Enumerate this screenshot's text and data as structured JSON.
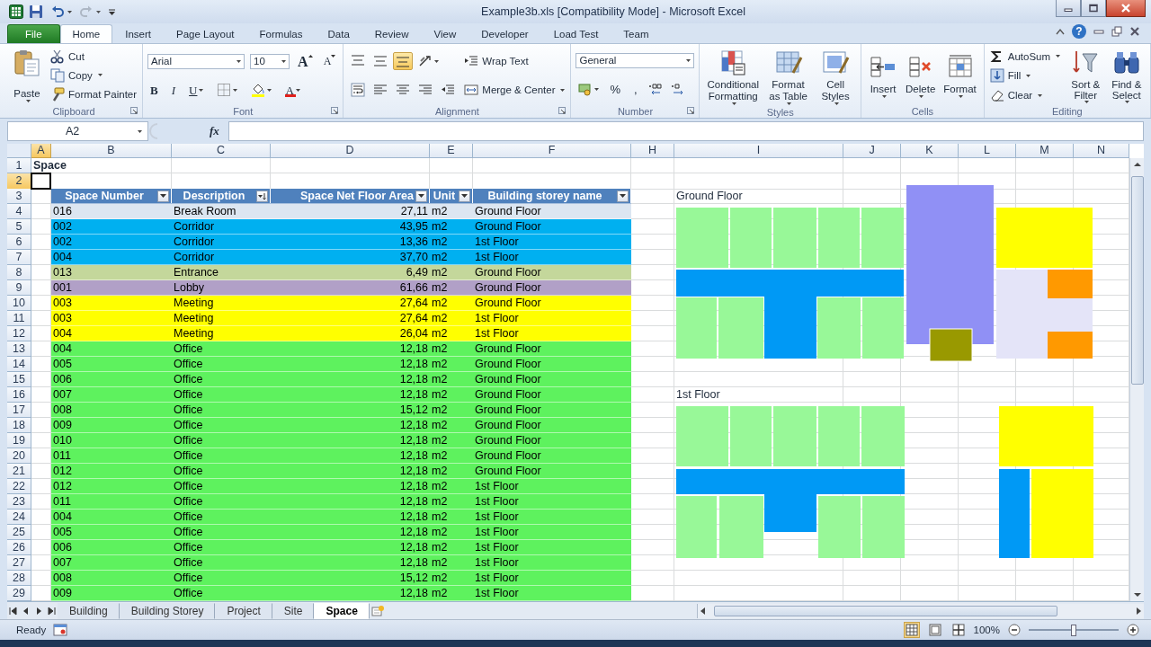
{
  "window": {
    "title": "Example3b.xls  [Compatibility Mode]  -  Microsoft Excel",
    "help": "?"
  },
  "ribbon_tabs": [
    {
      "label": "File",
      "kind": "file",
      "selected": false
    },
    {
      "label": "Home",
      "kind": "tab",
      "selected": true
    },
    {
      "label": "Insert",
      "kind": "tab",
      "selected": false
    },
    {
      "label": "Page Layout",
      "kind": "tab",
      "selected": false
    },
    {
      "label": "Formulas",
      "kind": "tab",
      "selected": false
    },
    {
      "label": "Data",
      "kind": "tab",
      "selected": false
    },
    {
      "label": "Review",
      "kind": "tab",
      "selected": false
    },
    {
      "label": "View",
      "kind": "tab",
      "selected": false
    },
    {
      "label": "Developer",
      "kind": "tab",
      "selected": false
    },
    {
      "label": "Load Test",
      "kind": "tab",
      "selected": false
    },
    {
      "label": "Team",
      "kind": "tab",
      "selected": false
    }
  ],
  "ribbon_groups": [
    {
      "title": "Clipboard",
      "launcher": true,
      "columns": [
        {
          "rows": [
            [
              {
                "kind": "large",
                "label": "Paste",
                "dropdown": true
              }
            ]
          ]
        },
        {
          "rows": [
            [
              {
                "kind": "small",
                "label": "Cut",
                "dropdown": false
              }
            ],
            [
              {
                "kind": "small",
                "label": "Copy",
                "dropdown": true
              }
            ],
            [
              {
                "kind": "small",
                "label": "Format Painter",
                "dropdown": false
              }
            ]
          ]
        }
      ]
    },
    {
      "title": "Font",
      "launcher": true,
      "columns": [
        {
          "rows": [
            [
              {
                "kind": "combo",
                "value": "Arial",
                "dropdown": true
              },
              {
                "kind": "combo",
                "value": "10",
                "dropdown": true
              },
              {
                "kind": "grow",
                "text": "A",
                "dropdown": false
              },
              {
                "kind": "shrink",
                "text": "A",
                "dropdown": false
              }
            ],
            [
              {
                "kind": "bold",
                "text": "B",
                "dropdown": false
              },
              {
                "kind": "italic",
                "text": "I",
                "dropdown": false
              },
              {
                "kind": "underline",
                "text": "U",
                "dropdown": true
              },
              {
                "kind": "icon",
                "dropdown": true
              },
              {
                "kind": "icon",
                "dropdown": true
              },
              {
                "kind": "fontcolor",
                "text": "A",
                "dropdown": true
              }
            ]
          ]
        }
      ]
    },
    {
      "title": "Alignment",
      "launcher": true,
      "columns": [
        {
          "rows": [
            [
              {
                "kind": "icon",
                "dropdown": false,
                "selected": false
              },
              {
                "kind": "icon",
                "dropdown": false,
                "selected": false
              },
              {
                "kind": "icon",
                "dropdown": false,
                "selected": true
              },
              {
                "kind": "icon",
                "dropdown": true
              }
            ],
            [
              {
                "kind": "icon",
                "dropdown": false,
                "selected": false
              },
              {
                "kind": "icon",
                "dropdown": false,
                "selected": false
              },
              {
                "kind": "icon",
                "dropdown": false,
                "selected": false
              },
              {
                "kind": "icon",
                "dropdown": false
              },
              {
                "kind": "icon",
                "dropdown": false
              }
            ]
          ]
        },
        {
          "rows": [
            [
              {
                "kind": "small",
                "label": "Wrap Text",
                "dropdown": false
              }
            ],
            [
              {
                "kind": "small",
                "label": "Merge & Center",
                "dropdown": true
              }
            ]
          ]
        }
      ]
    },
    {
      "title": "Number",
      "launcher": true,
      "columns": [
        {
          "rows": [
            [
              {
                "kind": "combo",
                "value": "General",
                "dropdown": true
              }
            ],
            [
              {
                "kind": "icon",
                "dropdown": true
              },
              {
                "kind": "symbol",
                "text": "%",
                "dropdown": false
              },
              {
                "kind": "symbol",
                "text": ",",
                "dropdown": false
              },
              {
                "kind": "icon",
                "dropdown": false
              },
              {
                "kind": "icon",
                "dropdown": false
              }
            ]
          ]
        }
      ]
    },
    {
      "title": "Styles",
      "launcher": false,
      "columns": [
        {
          "rows": [
            [
              {
                "kind": "large",
                "label": "Conditional Formatting",
                "dropdown": true
              },
              {
                "kind": "large",
                "label": "Format as Table",
                "dropdown": true
              },
              {
                "kind": "large",
                "label": "Cell Styles",
                "dropdown": true
              }
            ]
          ]
        }
      ]
    },
    {
      "title": "Cells",
      "launcher": false,
      "columns": [
        {
          "rows": [
            [
              {
                "kind": "large",
                "label": "Insert",
                "dropdown": true
              },
              {
                "kind": "large",
                "label": "Delete",
                "dropdown": true
              },
              {
                "kind": "large",
                "label": "Format",
                "dropdown": true
              }
            ]
          ]
        }
      ]
    },
    {
      "title": "Editing",
      "launcher": false,
      "columns": [
        {
          "rows": [
            [
              {
                "kind": "small",
                "label": "AutoSum",
                "dropdown": true
              }
            ],
            [
              {
                "kind": "small",
                "label": "Fill",
                "dropdown": true
              }
            ],
            [
              {
                "kind": "small",
                "label": "Clear",
                "dropdown": true
              }
            ]
          ]
        },
        {
          "rows": [
            [
              {
                "kind": "large",
                "label": "Sort & Filter",
                "dropdown": true
              },
              {
                "kind": "large",
                "label": "Find & Select",
                "dropdown": true
              }
            ]
          ]
        }
      ]
    }
  ],
  "formula_bar": {
    "name_box": "A2",
    "function_button": "fx"
  },
  "sheet": {
    "columns": [
      {
        "label": "A",
        "selected": true
      },
      {
        "label": "B",
        "selected": false
      },
      {
        "label": "C",
        "selected": false
      },
      {
        "label": "D",
        "selected": false
      },
      {
        "label": "E",
        "selected": false
      },
      {
        "label": "F",
        "selected": false
      },
      {
        "label": "H",
        "selected": false
      },
      {
        "label": "I",
        "selected": false
      },
      {
        "label": "J",
        "selected": false
      },
      {
        "label": "K",
        "selected": false
      },
      {
        "label": "L",
        "selected": false
      },
      {
        "label": "M",
        "selected": false
      },
      {
        "label": "N",
        "selected": false
      }
    ],
    "row_headers": [
      {
        "label": "1",
        "selected": false
      },
      {
        "label": "2",
        "selected": true
      },
      {
        "label": "3",
        "selected": false
      },
      {
        "label": "4",
        "selected": false
      },
      {
        "label": "5",
        "selected": false
      },
      {
        "label": "6",
        "selected": false
      },
      {
        "label": "7",
        "selected": false
      },
      {
        "label": "8",
        "selected": false
      },
      {
        "label": "9",
        "selected": false
      },
      {
        "label": "10",
        "selected": false
      },
      {
        "label": "11",
        "selected": false
      },
      {
        "label": "12",
        "selected": false
      },
      {
        "label": "13",
        "selected": false
      },
      {
        "label": "14",
        "selected": false
      },
      {
        "label": "15",
        "selected": false
      },
      {
        "label": "16",
        "selected": false
      },
      {
        "label": "17",
        "selected": false
      },
      {
        "label": "18",
        "selected": false
      },
      {
        "label": "19",
        "selected": false
      },
      {
        "label": "20",
        "selected": false
      },
      {
        "label": "21",
        "selected": false
      },
      {
        "label": "22",
        "selected": false
      },
      {
        "label": "23",
        "selected": false
      },
      {
        "label": "24",
        "selected": false
      },
      {
        "label": "25",
        "selected": false
      },
      {
        "label": "26",
        "selected": false
      },
      {
        "label": "27",
        "selected": false
      },
      {
        "label": "28",
        "selected": false
      },
      {
        "label": "29",
        "selected": false
      }
    ],
    "title_cell": "Space",
    "plan_labels": [
      "Ground Floor",
      "1st Floor"
    ],
    "table": {
      "columns": [
        {
          "label": "Space Number",
          "sorted": false
        },
        {
          "label": "Description",
          "sorted": true
        },
        {
          "label": "Space Net Floor Area",
          "sorted": false
        },
        {
          "label": "Unit",
          "sorted": false
        },
        {
          "label": "Building storey name",
          "sorted": false
        }
      ],
      "rows": [
        {
          "number": "016",
          "description": "Break Room",
          "area": "27,11",
          "unit": "m2",
          "storey": "Ground Floor",
          "color": "#dce6f1"
        },
        {
          "number": "002",
          "description": "Corridor",
          "area": "43,95",
          "unit": "m2",
          "storey": "Ground Floor",
          "color": "#00b0f0"
        },
        {
          "number": "002",
          "description": "Corridor",
          "area": "13,36",
          "unit": "m2",
          "storey": "1st Floor",
          "color": "#00b0f0"
        },
        {
          "number": "004",
          "description": "Corridor",
          "area": "37,70",
          "unit": "m2",
          "storey": "1st Floor",
          "color": "#00b0f0"
        },
        {
          "number": "013",
          "description": "Entrance",
          "area": "6,49",
          "unit": "m2",
          "storey": "Ground Floor",
          "color": "#c4d79b"
        },
        {
          "number": "001",
          "description": "Lobby",
          "area": "61,66",
          "unit": "m2",
          "storey": "Ground Floor",
          "color": "#b1a0c7"
        },
        {
          "number": "003",
          "description": "Meeting",
          "area": "27,64",
          "unit": "m2",
          "storey": "Ground Floor",
          "color": "#ffff00"
        },
        {
          "number": "003",
          "description": "Meeting",
          "area": "27,64",
          "unit": "m2",
          "storey": "1st Floor",
          "color": "#ffff00"
        },
        {
          "number": "004",
          "description": "Meeting",
          "area": "26,04",
          "unit": "m2",
          "storey": "1st Floor",
          "color": "#ffff00"
        },
        {
          "number": "004",
          "description": "Office",
          "area": "12,18",
          "unit": "m2",
          "storey": "Ground Floor",
          "color": "#5ef25e"
        },
        {
          "number": "005",
          "description": "Office",
          "area": "12,18",
          "unit": "m2",
          "storey": "Ground Floor",
          "color": "#5ef25e"
        },
        {
          "number": "006",
          "description": "Office",
          "area": "12,18",
          "unit": "m2",
          "storey": "Ground Floor",
          "color": "#5ef25e"
        },
        {
          "number": "007",
          "description": "Office",
          "area": "12,18",
          "unit": "m2",
          "storey": "Ground Floor",
          "color": "#5ef25e"
        },
        {
          "number": "008",
          "description": "Office",
          "area": "15,12",
          "unit": "m2",
          "storey": "Ground Floor",
          "color": "#5ef25e"
        },
        {
          "number": "009",
          "description": "Office",
          "area": "12,18",
          "unit": "m2",
          "storey": "Ground Floor",
          "color": "#5ef25e"
        },
        {
          "number": "010",
          "description": "Office",
          "area": "12,18",
          "unit": "m2",
          "storey": "Ground Floor",
          "color": "#5ef25e"
        },
        {
          "number": "011",
          "description": "Office",
          "area": "12,18",
          "unit": "m2",
          "storey": "Ground Floor",
          "color": "#5ef25e"
        },
        {
          "number": "012",
          "description": "Office",
          "area": "12,18",
          "unit": "m2",
          "storey": "Ground Floor",
          "color": "#5ef25e"
        },
        {
          "number": "012",
          "description": "Office",
          "area": "12,18",
          "unit": "m2",
          "storey": "1st Floor",
          "color": "#5ef25e"
        },
        {
          "number": "011",
          "description": "Office",
          "area": "12,18",
          "unit": "m2",
          "storey": "1st Floor",
          "color": "#5ef25e"
        },
        {
          "number": "004",
          "description": "Office",
          "area": "12,18",
          "unit": "m2",
          "storey": "1st Floor",
          "color": "#5ef25e"
        },
        {
          "number": "005",
          "description": "Office",
          "area": "12,18",
          "unit": "m2",
          "storey": "1st Floor",
          "color": "#5ef25e"
        },
        {
          "number": "006",
          "description": "Office",
          "area": "12,18",
          "unit": "m2",
          "storey": "1st Floor",
          "color": "#5ef25e"
        },
        {
          "number": "007",
          "description": "Office",
          "area": "12,18",
          "unit": "m2",
          "storey": "1st Floor",
          "color": "#5ef25e"
        },
        {
          "number": "008",
          "description": "Office",
          "area": "15,12",
          "unit": "m2",
          "storey": "1st Floor",
          "color": "#5ef25e"
        },
        {
          "number": "009",
          "description": "Office",
          "area": "12,18",
          "unit": "m2",
          "storey": "1st Floor",
          "color": "#5ef25e"
        }
      ]
    }
  },
  "sheet_tabs": [
    {
      "label": "Building",
      "selected": false
    },
    {
      "label": "Building Storey",
      "selected": false
    },
    {
      "label": "Project",
      "selected": false
    },
    {
      "label": "Site",
      "selected": false
    },
    {
      "label": "Space",
      "selected": true
    }
  ],
  "status_bar": {
    "status": "Ready",
    "zoom": "100%",
    "views": [
      {
        "selected": true
      },
      {
        "selected": false
      },
      {
        "selected": false
      }
    ],
    "zoom_slider": {
      "level": 0.5
    }
  }
}
